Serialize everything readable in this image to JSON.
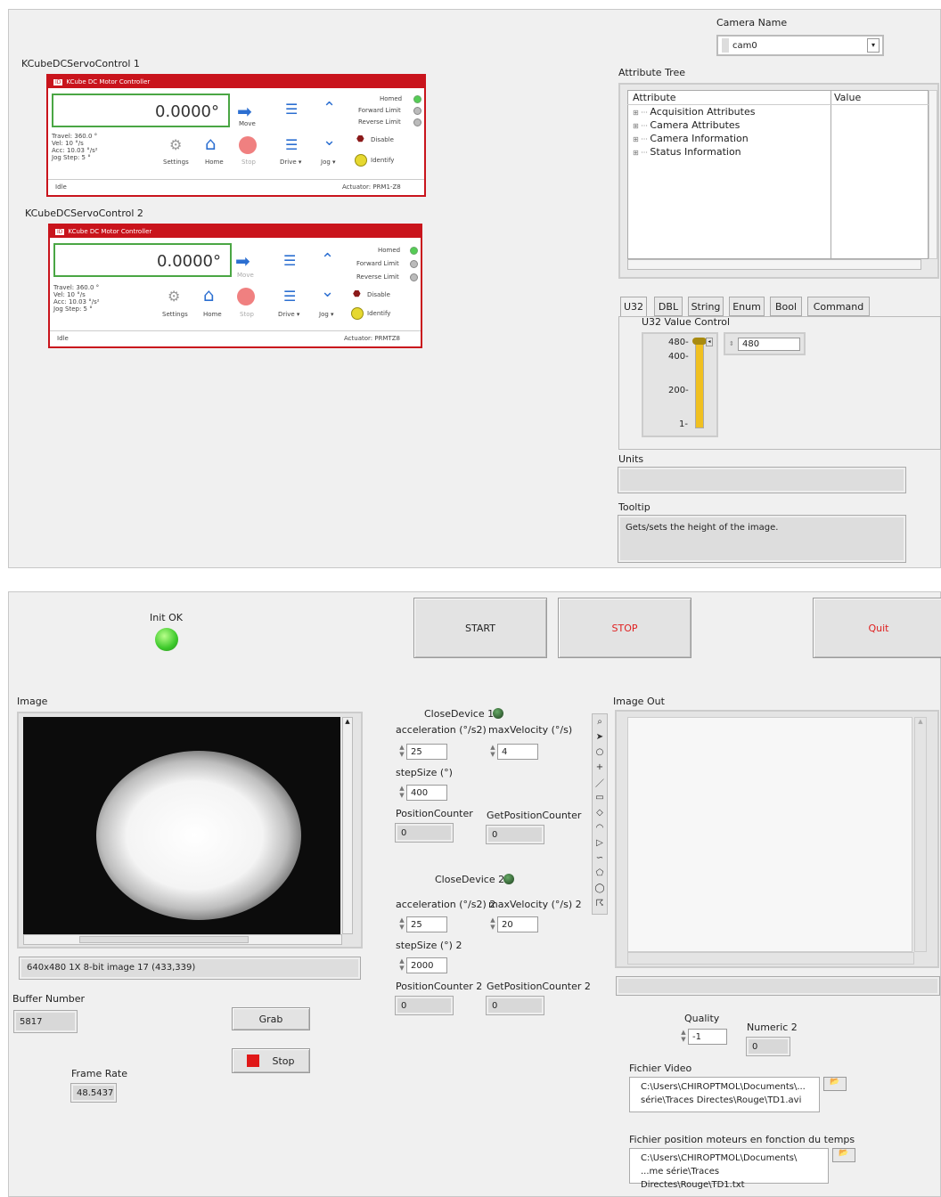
{
  "top": {
    "ctrl1_caption": "KCubeDCServoControl 1",
    "ctrl2_caption": "KCubeDCServoControl 2",
    "controllers": [
      {
        "title": "KCube DC Motor Controller",
        "position": "0.0000°",
        "travel": "Travel: 360.0 °",
        "vel": "Vel: 10 °/s",
        "acc": "Acc: 10.03 °/s²",
        "jog": "Jog Step: 5 °",
        "move": "Move",
        "settings": "Settings",
        "home": "Home",
        "stop": "Stop",
        "drive": "Drive ▾",
        "jogbtn": "Jog ▾",
        "homed": "Homed",
        "fwd": "Forward Limit",
        "rev": "Reverse Limit",
        "disable": "Disable",
        "identify": "Identify",
        "status": "Idle",
        "actuator": "Actuator:  PRM1-Z8"
      },
      {
        "title": "KCube DC Motor Controller",
        "position": "0.0000°",
        "travel": "Travel: 360.0 °",
        "vel": "Vel: 10 °/s",
        "acc": "Acc: 10.03 °/s²",
        "jog": "Jog Step: 5 °",
        "move": "Move",
        "settings": "Settings",
        "home": "Home",
        "stop": "Stop",
        "drive": "Drive ▾",
        "jogbtn": "Jog ▾",
        "homed": "Homed",
        "fwd": "Forward Limit",
        "rev": "Reverse Limit",
        "disable": "Disable",
        "identify": "Identify",
        "status": "Idle",
        "actuator": "Actuator:  PRMTZ8"
      }
    ],
    "camera_name_label": "Camera Name",
    "camera_name_value": "cam0",
    "attr_tree_label": "Attribute Tree",
    "attr_col": "Attribute",
    "value_col": "Value",
    "attr_items": [
      "Acquisition Attributes",
      "Camera Attributes",
      "Camera Information",
      "Status Information"
    ],
    "tabs": [
      "U32",
      "DBL",
      "String",
      "Enum",
      "Bool",
      "Command"
    ],
    "u32_label": "U32 Value Control",
    "slider_ticks": [
      "480-",
      "400-",
      "200-",
      "1-"
    ],
    "slider_level": 1.0,
    "u32_value": "480",
    "units_label": "Units",
    "units_value": "",
    "tooltip_label": "Tooltip",
    "tooltip_value": "Gets/sets the height of the image."
  },
  "bottom": {
    "init_label": "Init OK",
    "start": "START",
    "stop": "STOP",
    "quit": "Quit",
    "image_label": "Image",
    "image_info": "640x480 1X 8-bit image 17    (433,339)",
    "buffer_label": "Buffer Number",
    "buffer_value": "5817",
    "grab": "Grab",
    "stop2": "Stop",
    "frame_rate_label": "Frame Rate",
    "frame_rate_value": "48.5437",
    "dev1": {
      "close": "CloseDevice 1",
      "acc_label": "acceleration (°/s2)",
      "acc": "25",
      "vel_label": "maxVelocity  (°/s)",
      "vel": "4",
      "step_label": "stepSize (°)",
      "step": "400",
      "pc_label": "PositionCounter",
      "pc": "0",
      "gpc_label": "GetPositionCounter",
      "gpc": "0"
    },
    "dev2": {
      "close": "CloseDevice 2",
      "acc_label": "acceleration (°/s2) 2",
      "acc": "25",
      "vel_label": "maxVelocity  (°/s) 2",
      "vel": "20",
      "step_label": "stepSize (°) 2",
      "step": "2000",
      "pc_label": "PositionCounter 2",
      "pc": "0",
      "gpc_label": "GetPositionCounter 2",
      "gpc": "0"
    },
    "image_out_label": "Image Out",
    "quality_label": "Quality",
    "quality_value": "-1",
    "numeric2_label": "Numeric 2",
    "numeric2_value": "0",
    "video_label": "Fichier Video",
    "video_path1": "C:\\Users\\CHIROPTMOL\\Documents\\...",
    "video_path2": "série\\Traces Directes\\Rouge\\TD1.avi",
    "pos_label": "Fichier position moteurs en fonction du temps",
    "pos_path1": "C:\\Users\\CHIROPTMOL\\Documents\\",
    "pos_path2": "...me série\\Traces Directes\\Rouge\\TD1.txt"
  }
}
